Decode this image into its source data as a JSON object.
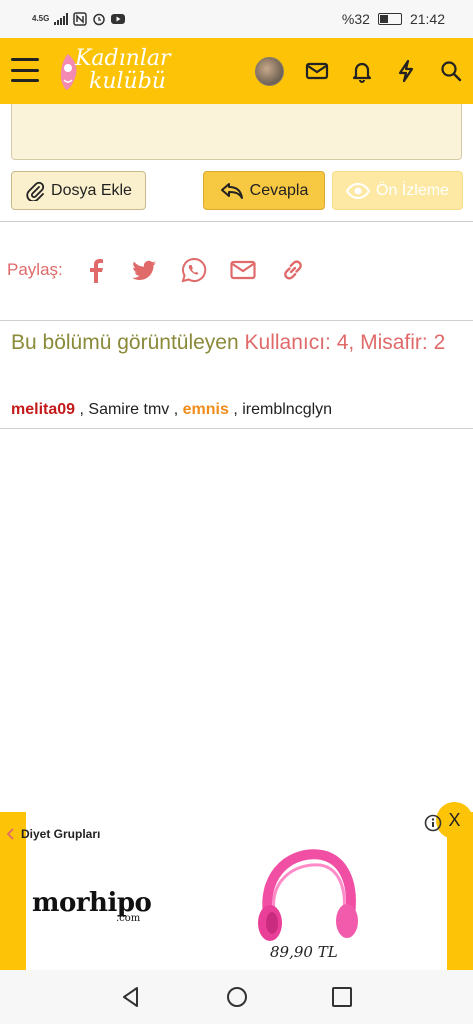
{
  "status_bar": {
    "network": "4.5G",
    "battery_percent": "%32",
    "time": "21:42"
  },
  "header": {
    "logo_line1": "Kadınlar",
    "logo_line2": "kulübü",
    "icons": [
      "menu-icon",
      "avatar",
      "mail-icon",
      "bell-icon",
      "flash-icon",
      "search-icon"
    ]
  },
  "actions": {
    "attach_label": "Dosya Ekle",
    "reply_label": "Cevapla",
    "preview_label": "Ön İzleme"
  },
  "share": {
    "label": "Paylaş:",
    "icons": [
      "facebook-icon",
      "twitter-icon",
      "whatsapp-icon",
      "email-icon",
      "link-icon"
    ]
  },
  "viewers": {
    "lead": "Bu bölümü görüntüleyen",
    "count": "Kullanıcı: 4, Misafir: 2",
    "users": [
      {
        "name": "melita09",
        "style": "red-bold"
      },
      {
        "name": "Samire tmv",
        "style": "normal"
      },
      {
        "name": "emnis",
        "style": "orange-bold"
      },
      {
        "name": "iremblncglyn",
        "style": "normal"
      }
    ],
    "separator": " , "
  },
  "ad": {
    "close_label": "X",
    "breadcrumb": "Diyet Grupları",
    "brand": "morhipo",
    "brand_sub": ".com",
    "price": "89,90 TL"
  },
  "colors": {
    "brand_yellow": "#fcc307",
    "share_red": "#e06a6a",
    "viewers_olive": "#8a8a3a"
  }
}
